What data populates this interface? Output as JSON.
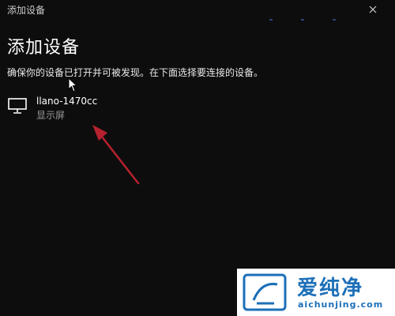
{
  "window": {
    "title": "添加设备"
  },
  "dialog": {
    "heading": "添加设备",
    "instructions": "确保你的设备已打开并可被发现。在下面选择要连接的设备。"
  },
  "devices": [
    {
      "name": "llano-1470cc",
      "type": "显示屏",
      "icon": "monitor-icon"
    }
  ],
  "watermark": {
    "brand": "爱纯净",
    "url": "aichunjing.com"
  },
  "colors": {
    "background": "#0d0d0d",
    "arrow": "#b5212f",
    "watermark_blue": "#1c6fb8"
  }
}
